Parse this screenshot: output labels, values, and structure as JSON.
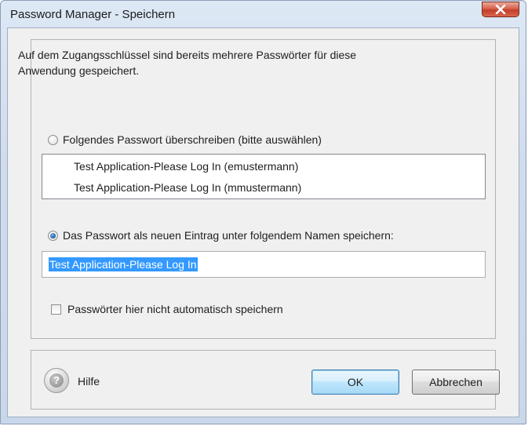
{
  "window": {
    "title": "Password Manager - Speichern",
    "close_glyph": "X"
  },
  "intro": {
    "line1": "Auf dem Zugangsschlüssel sind bereits mehrere Passwörter für diese",
    "line2": "Anwendung gespeichert."
  },
  "overwrite_option": {
    "label": "Folgendes Passwort überschreiben (bitte auswählen)",
    "selected": false
  },
  "password_list": {
    "items": [
      "Test Application-Please Log In (emustermann)",
      "Test Application-Please Log In (mmustermann)"
    ]
  },
  "new_entry_option": {
    "label": "Das Passwort als neuen Eintrag unter folgendem Namen speichern:",
    "selected": true
  },
  "entry_name": {
    "value": "Test Application-Please Log In"
  },
  "no_autosave": {
    "label": "Passwörter hier nicht automatisch speichern",
    "checked": false
  },
  "footer": {
    "help_glyph": "?",
    "help_label": "Hilfe",
    "ok_label": "OK",
    "cancel_label": "Abbrechen"
  },
  "colors": {
    "selection": "#3399ff",
    "close_button": "#c23f2a",
    "title_bar": "#dde8f5"
  },
  "icons": {
    "close": "close-icon",
    "help": "help-icon"
  }
}
